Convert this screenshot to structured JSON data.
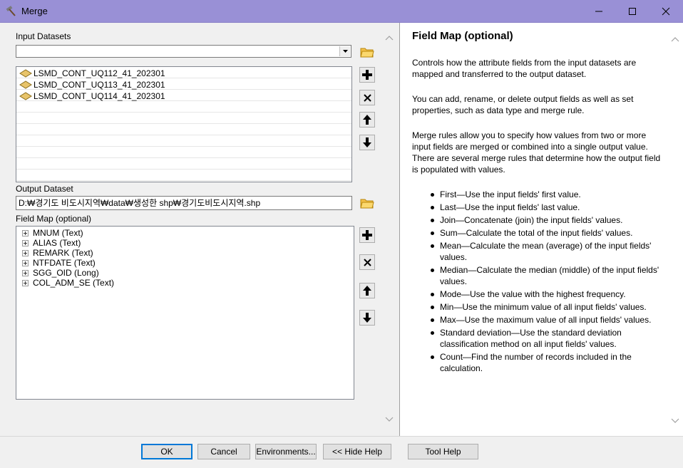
{
  "window": {
    "title": "Merge"
  },
  "labels": {
    "input_datasets": "Input Datasets",
    "output_dataset": "Output Dataset",
    "field_map": "Field Map (optional)"
  },
  "input_datasets": {
    "combo_value": "",
    "items": [
      "LSMD_CONT_UQ112_41_202301",
      "LSMD_CONT_UQ113_41_202301",
      "LSMD_CONT_UQ114_41_202301"
    ]
  },
  "output_dataset": {
    "value": "D:₩경기도 비도시지역₩data₩생성한 shp₩경기도비도시지역.shp"
  },
  "field_map": {
    "items": [
      "MNUM (Text)",
      "ALIAS (Text)",
      "REMARK (Text)",
      "NTFDATE (Text)",
      "SGG_OID (Long)",
      "COL_ADM_SE (Text)"
    ]
  },
  "help": {
    "title": "Field Map (optional)",
    "paragraphs": [
      "Controls how the attribute fields from the input datasets are mapped and transferred to the output dataset.",
      "You can add, rename, or delete output fields as well as set properties, such as data type and merge rule.",
      "Merge rules allow you to specify how values from two or more input fields are merged or combined into a single output value. There are several merge rules that determine how the output field is populated with values."
    ],
    "rules": [
      "First—Use the input fields' first value.",
      "Last—Use the input fields' last value.",
      "Join—Concatenate (join) the input fields' values.",
      "Sum—Calculate the total of the input fields' values.",
      "Mean—Calculate the mean (average) of the input fields' values.",
      "Median—Calculate the median (middle) of the input fields' values.",
      "Mode—Use the value with the highest frequency.",
      "Min—Use the minimum value of all input fields' values.",
      "Max—Use the maximum value of all input fields' values.",
      "Standard deviation—Use the standard deviation classification method on all input fields' values.",
      "Count—Find the number of records included in the calculation."
    ]
  },
  "buttons": {
    "ok": "OK",
    "cancel": "Cancel",
    "environments": "Environments...",
    "hide_help": "<< Hide Help",
    "tool_help": "Tool Help"
  },
  "icons": {
    "app": "hammer-icon",
    "folder": "open-folder-icon",
    "add": "plus-icon",
    "remove": "x-icon",
    "up": "arrow-up-icon",
    "down": "arrow-down-icon",
    "dataset": "polygon-layer-icon"
  },
  "colors": {
    "titlebar": "#9990d6",
    "default_button_border": "#0078d7",
    "folder": "#f5c24a",
    "dataset": "#e8c46a"
  }
}
